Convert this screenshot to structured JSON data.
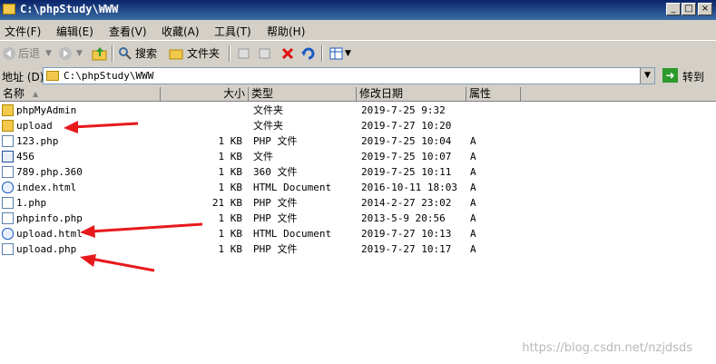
{
  "window": {
    "title": "C:\\phpStudy\\WWW"
  },
  "menu": [
    "文件(F)",
    "编辑(E)",
    "查看(V)",
    "收藏(A)",
    "工具(T)",
    "帮助(H)"
  ],
  "toolbar": {
    "back": "后退",
    "search": "搜索",
    "folders": "文件夹"
  },
  "address": {
    "label": "地址 (D)",
    "value": "C:\\phpStudy\\WWW",
    "go": "转到"
  },
  "columns": {
    "name": "名称",
    "size": "大小",
    "type": "类型",
    "modified": "修改日期",
    "attr": "属性"
  },
  "files": [
    {
      "name": "phpMyAdmin",
      "size": "",
      "type": "文件夹",
      "date": "2019-7-25 9:32",
      "attr": "",
      "icon": "folder"
    },
    {
      "name": "upload",
      "size": "",
      "type": "文件夹",
      "date": "2019-7-27 10:20",
      "attr": "",
      "icon": "folder"
    },
    {
      "name": "123.php",
      "size": "1 KB",
      "type": "PHP 文件",
      "date": "2019-7-25 10:04",
      "attr": "A",
      "icon": "file"
    },
    {
      "name": "456",
      "size": "1 KB",
      "type": "文件",
      "date": "2019-7-25 10:07",
      "attr": "A",
      "icon": "exe"
    },
    {
      "name": "789.php.360",
      "size": "1 KB",
      "type": "360 文件",
      "date": "2019-7-25 10:11",
      "attr": "A",
      "icon": "file"
    },
    {
      "name": "index.html",
      "size": "1 KB",
      "type": "HTML Document",
      "date": "2016-10-11 18:03",
      "attr": "A",
      "icon": "html"
    },
    {
      "name": "1.php",
      "size": "21 KB",
      "type": "PHP 文件",
      "date": "2014-2-27 23:02",
      "attr": "A",
      "icon": "file"
    },
    {
      "name": "phpinfo.php",
      "size": "1 KB",
      "type": "PHP 文件",
      "date": "2013-5-9 20:56",
      "attr": "A",
      "icon": "file"
    },
    {
      "name": "upload.html",
      "size": "1 KB",
      "type": "HTML Document",
      "date": "2019-7-27 10:13",
      "attr": "A",
      "icon": "html"
    },
    {
      "name": "upload.php",
      "size": "1 KB",
      "type": "PHP 文件",
      "date": "2019-7-27 10:17",
      "attr": "A",
      "icon": "file"
    }
  ],
  "watermark": "https://blog.csdn.net/nzjdsds",
  "colors": {
    "annotation": "#e8191b",
    "title_bar": "#0a246a"
  }
}
